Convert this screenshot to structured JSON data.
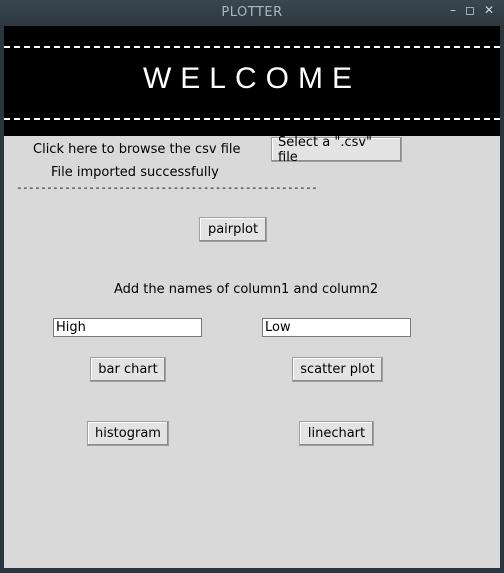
{
  "window": {
    "title": "PLOTTER",
    "controls": {
      "minimize": "–",
      "maximize": "◻",
      "close": "✕"
    }
  },
  "banner": {
    "welcome": "WELCOME"
  },
  "browse": {
    "label": "Click here to browse the csv file",
    "button": "Select a \".csv\" file",
    "status": "File imported successfully",
    "separator": "--------------------------------------------------"
  },
  "pairplot": {
    "button": "pairplot"
  },
  "columns": {
    "instruction": "Add the names of column1 and column2",
    "column1_value": "High",
    "column2_value": "Low"
  },
  "charts": {
    "bar_chart": "bar chart",
    "scatter_plot": "scatter plot",
    "histogram": "histogram",
    "linechart": "linechart"
  },
  "colors": {
    "banner": "#000000",
    "client_bg": "#d9d9d9",
    "titlebar": "#2c3740"
  }
}
